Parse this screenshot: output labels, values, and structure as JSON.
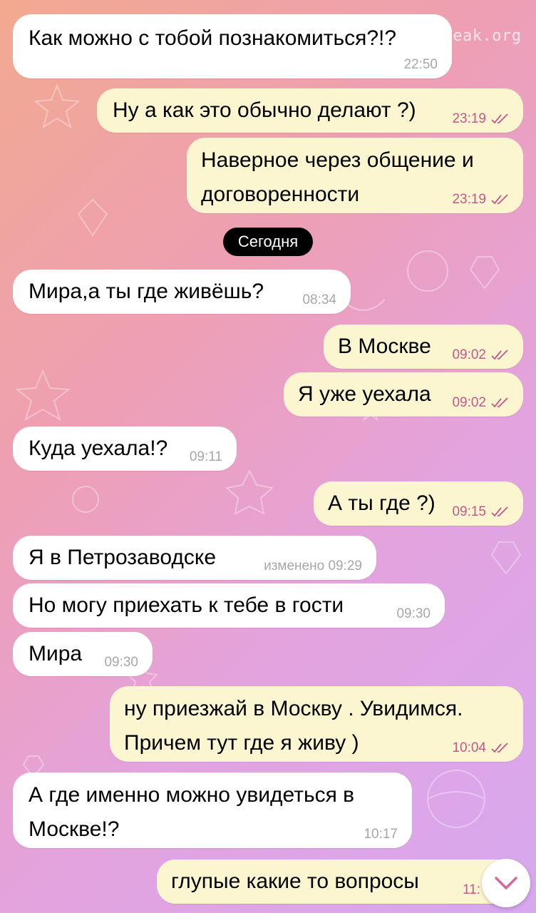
{
  "watermark": "myleak.org",
  "date_chip": "Сегодня",
  "messages": [
    {
      "text": "Как можно с тобой познакомиться?!?",
      "time": "22:50",
      "edited": ""
    },
    {
      "text": "Ну а как это обычно делают ?)",
      "time": "23:19"
    },
    {
      "text": "Наверное через общение и\nдоговоренности",
      "time": "23:19"
    },
    {
      "text": "Мира,а ты где живёшь?",
      "time": "08:34"
    },
    {
      "text": "В Москве",
      "time": "09:02"
    },
    {
      "text": "Я уже уехала",
      "time": "09:02"
    },
    {
      "text": "Куда уехала!?",
      "time": "09:11"
    },
    {
      "text": "А ты где ?)",
      "time": "09:15"
    },
    {
      "text": "Я в Петрозаводске",
      "time": "изменено 09:29"
    },
    {
      "text": "Но могу приехать к тебе в гости",
      "time": "09:30"
    },
    {
      "text": "Мира",
      "time": "09:30"
    },
    {
      "text": "ну приезжай в Москву . Увидимся.\nПричем тут где я живу )",
      "time": "10:04"
    },
    {
      "text": "А где именно можно увидеться в\nМоскве!?",
      "time": "10:17"
    },
    {
      "text": "глупые какие то вопросы",
      "time": "11:"
    }
  ],
  "colors": {
    "incoming": "#ffffff",
    "outgoing": "#fbf6cf",
    "outgoing_meta": "#c4588a"
  },
  "icons": {
    "read": "double-check-icon",
    "scroll": "chevron-down-icon"
  }
}
